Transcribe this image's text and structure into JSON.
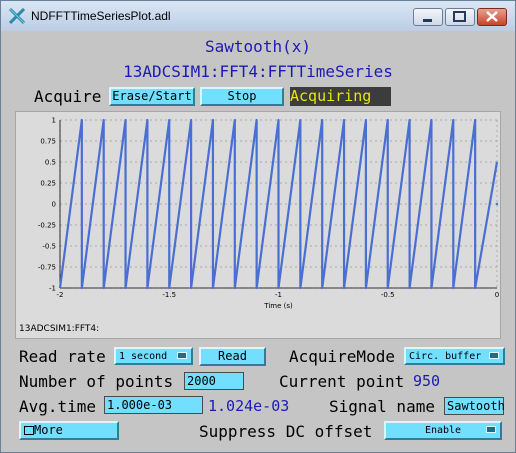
{
  "window": {
    "title": "NDFFTTimeSeriesPlot.adl"
  },
  "header": {
    "line1": "Sawtooth(x)",
    "line2": "13ADCSIM1:FFT4:FFTTimeSeries"
  },
  "acquire": {
    "label": "Acquire",
    "erase_start": "Erase/Start",
    "stop": "Stop",
    "status": "Acquiring",
    "status_color": "#e8e800",
    "status_bg": "#3c3c3c"
  },
  "plot": {
    "footer": "13ADCSIM1:FFT4:"
  },
  "chart_data": {
    "type": "line",
    "title": "",
    "xlabel": "Time (s)",
    "ylabel": "",
    "xlim": [
      -2,
      0
    ],
    "ylim": [
      -1,
      1
    ],
    "x_ticks": [
      "-2",
      "-1.5",
      "-1",
      "-0.5",
      "0"
    ],
    "y_ticks": [
      "1",
      "0.75",
      "0.5",
      "0.25",
      "0",
      "-0.25",
      "-0.5",
      "-0.75",
      "-1"
    ],
    "series": [
      {
        "color": "#4a6fd2",
        "waveform": "sawtooth",
        "amplitude": 1,
        "period_s": 0.1,
        "x_start": -2,
        "x_end": 0,
        "last_value": 0.5
      }
    ],
    "grid": true
  },
  "controls": {
    "read_rate": {
      "label": "Read rate",
      "value": "1 second",
      "button": "Read"
    },
    "acquire_mode": {
      "label": "AcquireMode",
      "value": "Circ. buffer"
    },
    "points": {
      "label": "Number of points",
      "value": "2000"
    },
    "current_point": {
      "label": "Current point",
      "value": "950"
    },
    "avg_time": {
      "label": "Avg.time",
      "value": "1.000e-03",
      "readback": "1.024e-03"
    },
    "signal_name": {
      "label": "Signal name",
      "value": "Sawtooth"
    },
    "more": {
      "label": "More"
    },
    "suppress_dc": {
      "label": "Suppress DC offset",
      "value": "Enable"
    }
  }
}
